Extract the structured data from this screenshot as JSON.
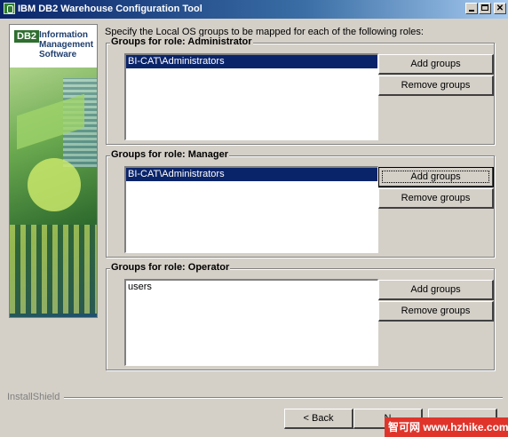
{
  "window": {
    "title": "IBM DB2 Warehouse Configuration Tool",
    "controls": [
      "minimize",
      "maximize",
      "close"
    ]
  },
  "banner": {
    "logo": "DB2",
    "text_line1": "Information",
    "text_line2": "Management",
    "text_line3": "Software"
  },
  "instruction": "Specify the Local OS groups to be mapped for each of the following roles:",
  "groups": [
    {
      "title": "Groups for role: Administrator",
      "items": [
        {
          "label": "BI-CAT\\Administrators",
          "selected": true
        }
      ],
      "add_label": "Add groups",
      "remove_label": "Remove groups"
    },
    {
      "title": "Groups for role: Manager",
      "items": [
        {
          "label": "BI-CAT\\Administrators",
          "selected": true
        }
      ],
      "add_label": "Add groups",
      "remove_label": "Remove groups",
      "focused_button": "add"
    },
    {
      "title": "Groups for role: Operator",
      "items": [
        {
          "label": "users",
          "selected": false
        }
      ],
      "add_label": "Add groups",
      "remove_label": "Remove groups"
    }
  ],
  "footer": {
    "installshield": "InstallShield",
    "back_label": "< Back",
    "next_label": "N",
    "cancel_label": ""
  },
  "watermark": "智可网 www.hzhike.com",
  "colors": {
    "title_bar": "#0a246a",
    "selection": "#0a246a",
    "face": "#d4d0c8"
  }
}
